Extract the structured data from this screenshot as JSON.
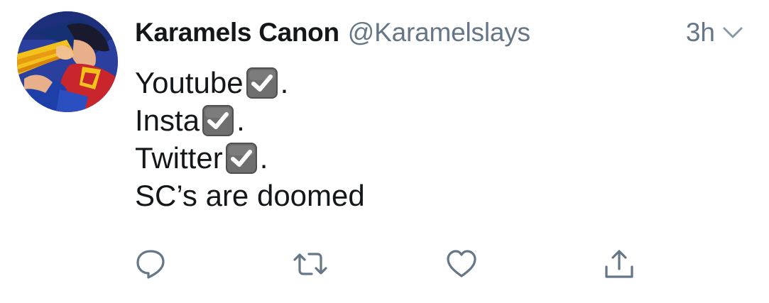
{
  "tweet": {
    "display_name": "Karamels Canon",
    "handle": "@Karamelslays",
    "time": "3h",
    "lines": [
      {
        "text": "Youtube",
        "check": true,
        "suffix": "."
      },
      {
        "text": "Insta",
        "check": true,
        "suffix": "."
      },
      {
        "text": "Twitter",
        "check": true,
        "suffix": "."
      },
      {
        "text": "SC’s are doomed",
        "check": false,
        "suffix": ""
      }
    ]
  },
  "icons": {
    "avatar": "avatar-image",
    "more": "chevron-down-icon",
    "check": "check-mark-button-emoji",
    "reply": "reply-icon",
    "retweet": "retweet-icon",
    "like": "heart-icon",
    "share": "share-icon"
  },
  "colors": {
    "text": "#14171a",
    "secondary": "#657786",
    "background": "#ffffff"
  }
}
